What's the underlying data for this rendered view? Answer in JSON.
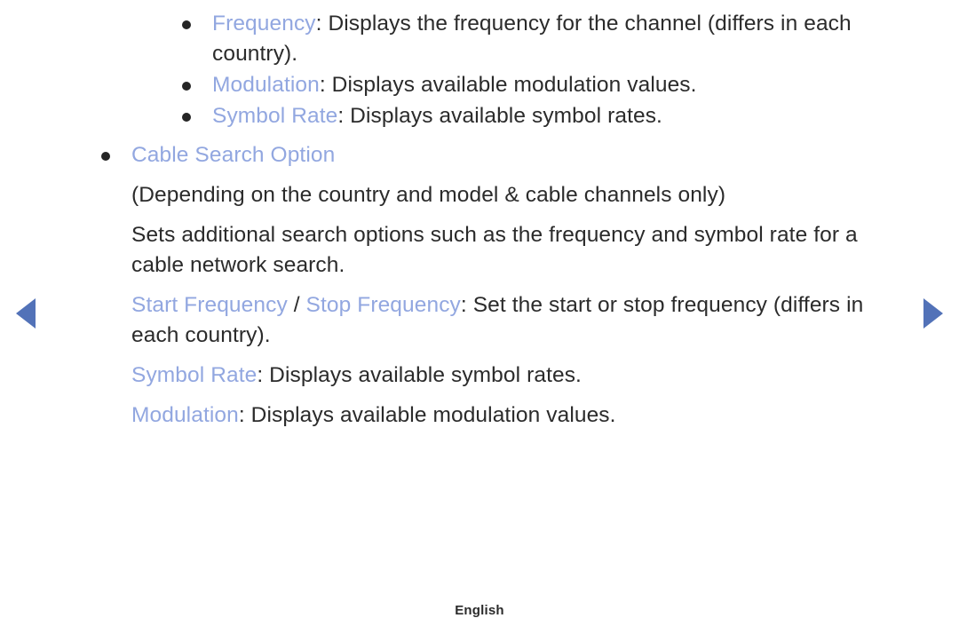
{
  "nav": {
    "prev_label": "previous-page",
    "next_label": "next-page",
    "arrow_color": "#5272b8"
  },
  "colors": {
    "emphasis": "#92a7e0",
    "body_text": "#2b2b2b",
    "background": "#ffffff",
    "bullet": "#252525"
  },
  "content": {
    "bullets_level2": [
      {
        "term": "Frequency",
        "description": ": Displays the frequency for the channel (differs in each country)."
      },
      {
        "term": "Modulation",
        "description": ": Displays available modulation values."
      },
      {
        "term": "Symbol Rate",
        "description": ": Displays available symbol rates."
      }
    ],
    "section": {
      "heading": "Cable Search Option",
      "note": "(Depending on the country and model & cable channels only)",
      "body": "Sets additional search options such as the frequency and symbol rate for a cable network search.",
      "items": [
        {
          "term_a": "Start Frequency",
          "separator": " / ",
          "term_b": "Stop Frequency",
          "description": ": Set the start or stop frequency (differs in each country)."
        },
        {
          "term_a": "Symbol Rate",
          "separator": "",
          "term_b": "",
          "description": ": Displays available symbol rates."
        },
        {
          "term_a": "Modulation",
          "separator": "",
          "term_b": "",
          "description": ": Displays available modulation values."
        }
      ]
    }
  },
  "footer": {
    "language": "English"
  }
}
